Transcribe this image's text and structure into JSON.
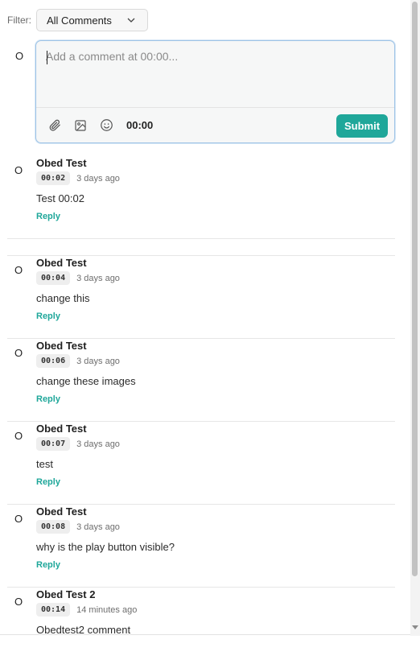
{
  "filter": {
    "label": "Filter:",
    "selected": "All Comments"
  },
  "composer": {
    "avatar": "O",
    "placeholder": "Add a comment at 00:00...",
    "time": "00:00",
    "submit_label": "Submit",
    "icons": [
      "paperclip-icon",
      "image-icon",
      "emoji-icon"
    ]
  },
  "comments": [
    {
      "avatar": "O",
      "author": "Obed Test",
      "timestamp": "00:02",
      "ago": "3 days ago",
      "text": "Test 00:02",
      "reply": "Reply"
    },
    {
      "avatar": "O",
      "author": "Obed Test",
      "timestamp": "00:04",
      "ago": "3 days ago",
      "text": "change this",
      "reply": "Reply"
    },
    {
      "avatar": "O",
      "author": "Obed Test",
      "timestamp": "00:06",
      "ago": "3 days ago",
      "text": "change these images",
      "reply": "Reply"
    },
    {
      "avatar": "O",
      "author": "Obed Test",
      "timestamp": "00:07",
      "ago": "3 days ago",
      "text": "test",
      "reply": "Reply"
    },
    {
      "avatar": "O",
      "author": "Obed Test",
      "timestamp": "00:08",
      "ago": "3 days ago",
      "text": "why is the play button visible?",
      "reply": "Reply"
    },
    {
      "avatar": "O",
      "author": "Obed Test 2",
      "timestamp": "00:14",
      "ago": "14 minutes ago",
      "text": "Obedtest2 comment"
    }
  ],
  "colors": {
    "accent": "#1fa79a",
    "focus_border": "#9ec3e6"
  }
}
